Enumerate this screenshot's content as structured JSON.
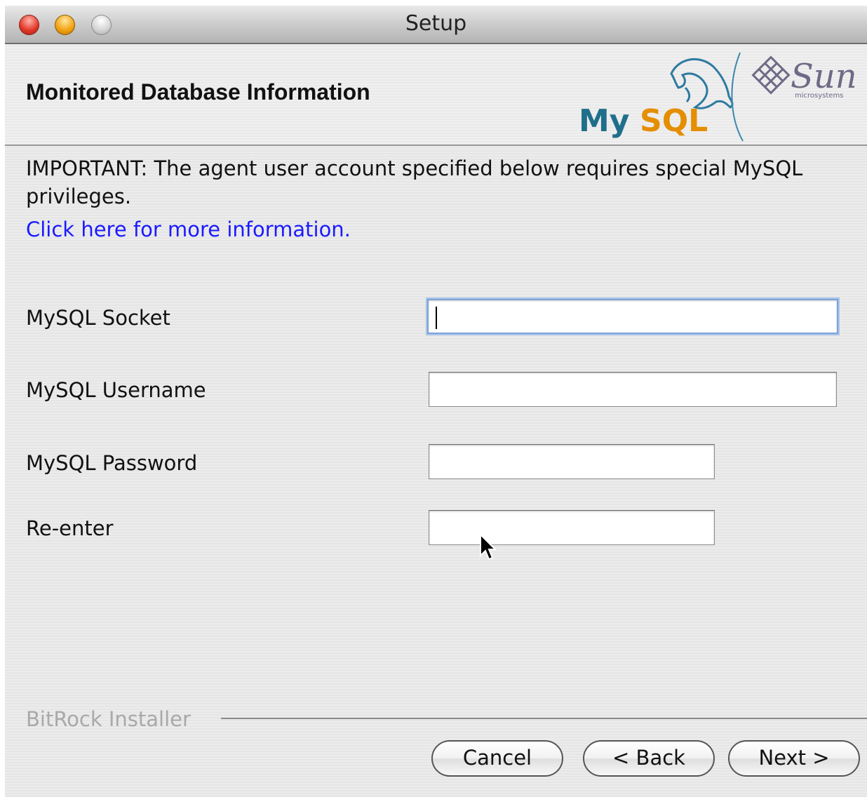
{
  "window": {
    "title": "Setup"
  },
  "header": {
    "title": "Monitored Database Information",
    "logo_text": {
      "mysql": "MySQL",
      "sun": "Sun",
      "sun_sub": "microsystems"
    }
  },
  "notice": {
    "text": "IMPORTANT: The agent user account specified below requires special MySQL privileges.",
    "link": "Click here for more information."
  },
  "form": {
    "fields": [
      {
        "label": "MySQL Socket",
        "value": ""
      },
      {
        "label": "MySQL Username",
        "value": ""
      },
      {
        "label": "MySQL Password",
        "value": ""
      },
      {
        "label": "Re-enter",
        "value": ""
      }
    ]
  },
  "footer": {
    "brand": "BitRock Installer",
    "buttons": {
      "cancel": "Cancel",
      "back": "< Back",
      "next": "Next >"
    }
  },
  "colors": {
    "link": "#1b1bff",
    "focus_ring": "#7ea3d6",
    "mysql_blue": "#1f6f8b",
    "mysql_orange": "#e48e00"
  }
}
